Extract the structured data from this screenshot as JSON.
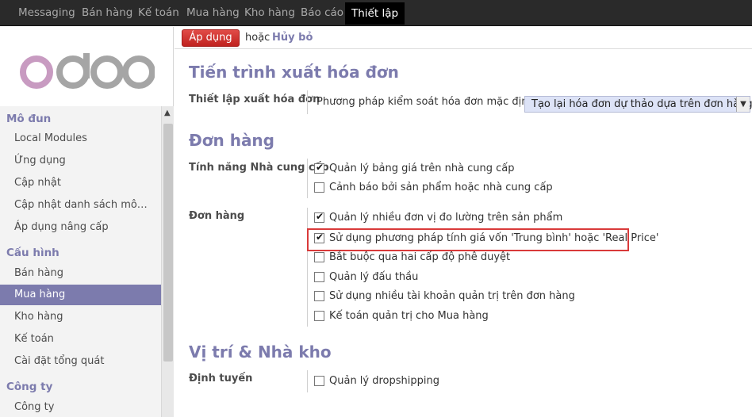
{
  "topbar": {
    "menus": [
      "Messaging",
      "Bán hàng",
      "Kế toán",
      "Mua hàng",
      "Kho hàng",
      "Báo cáo",
      "Thiết lập"
    ]
  },
  "sidebar": {
    "sections": [
      {
        "title": "Mô đun",
        "items": [
          "Local Modules",
          "Ứng dụng",
          "Cập nhật",
          "Cập nhật danh sách mô…",
          "Áp dụng nâng cấp"
        ]
      },
      {
        "title": "Cấu hình",
        "items": [
          "Bán hàng",
          "Mua hàng",
          "Kho hàng",
          "Kế toán",
          "Cài đặt tổng quát"
        ]
      },
      {
        "title": "Công ty",
        "items": [
          "Công ty"
        ]
      }
    ],
    "active_item": "Mua hàng"
  },
  "actionbar": {
    "apply_label": "Áp dụng",
    "or_label": "hoặc",
    "cancel_label": "Hủy bỏ"
  },
  "invoicing": {
    "title": "Tiến trình xuất hóa đơn",
    "field_label": "Thiết lập xuất hóa đơn",
    "sub_label": "Phương pháp kiểm soát hóa đơn mặc định",
    "select_value": "Tạo lại hóa đơn dự thảo dựa trên đơn hàng"
  },
  "orders": {
    "title": "Đơn hàng",
    "supplier_label": "Tính năng Nhà cung cấp",
    "supplier_options": [
      {
        "label": "Quản lý bảng giá trên nhà cung cấp",
        "checked": true
      },
      {
        "label": "Cảnh báo bởi sản phẩm hoặc nhà cung cấp",
        "checked": false
      }
    ],
    "order_label": "Đơn hàng",
    "order_options": [
      {
        "label": "Quản lý nhiều đơn vị đo lường trên sản phẩm",
        "checked": true
      },
      {
        "label": "Sử dụng phương pháp tính giá vốn 'Trung bình' hoặc 'Real Price'",
        "checked": true
      },
      {
        "label": "Bắt buộc qua hai cấp độ phê duyệt",
        "checked": false
      },
      {
        "label": "Quản lý đấu thầu",
        "checked": false
      },
      {
        "label": "Sử dụng nhiều tài khoản quản trị trên đơn hàng",
        "checked": false
      },
      {
        "label": "Kế toán quản trị cho Mua hàng",
        "checked": false
      }
    ]
  },
  "warehouse": {
    "title": "Vị trí & Nhà kho",
    "routing_label": "Định tuyến",
    "routing_options": [
      {
        "label": "Quản lý dropshipping",
        "checked": false
      }
    ]
  },
  "colors": {
    "accent": "#7c7bad",
    "apply_button": "#c0221f",
    "highlight_box": "#d93a3a"
  }
}
